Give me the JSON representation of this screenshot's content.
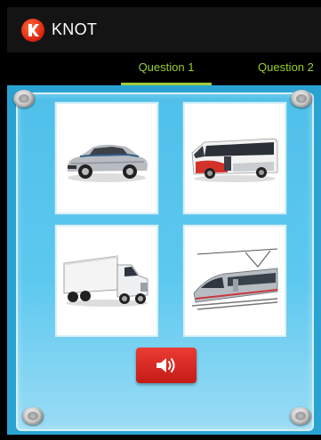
{
  "app": {
    "title": "KNOT",
    "icon": "knot-logo-icon"
  },
  "tabs": [
    {
      "label": "Question 1",
      "selected": true
    },
    {
      "label": "Question 2",
      "selected": false
    }
  ],
  "board": {
    "options": [
      {
        "icon": "car-icon"
      },
      {
        "icon": "bus-icon"
      },
      {
        "icon": "truck-icon"
      },
      {
        "icon": "tram-icon"
      }
    ],
    "speak_button": {
      "icon": "speaker-icon"
    }
  },
  "colors": {
    "action_bar": "#141414",
    "tab_text": "#9acd32",
    "tab_indicator": "#9fcc3b",
    "board": "#4fc0ea",
    "speak_button": "#d62a24"
  }
}
